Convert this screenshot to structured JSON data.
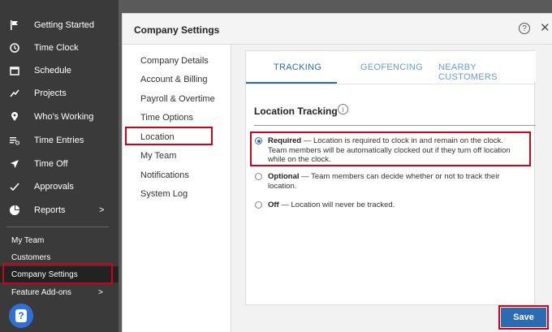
{
  "sidebar": {
    "items": [
      {
        "label": "Getting Started",
        "icon": "flag-icon"
      },
      {
        "label": "Time Clock",
        "icon": "clock-icon"
      },
      {
        "label": "Schedule",
        "icon": "calendar-icon"
      },
      {
        "label": "Projects",
        "icon": "projects-icon"
      },
      {
        "label": "Who's Working",
        "icon": "location-pin-icon"
      },
      {
        "label": "Time Entries",
        "icon": "time-entries-icon"
      },
      {
        "label": "Time Off",
        "icon": "plane-icon"
      },
      {
        "label": "Approvals",
        "icon": "checkmark-icon"
      },
      {
        "label": "Reports",
        "icon": "pie-chart-icon",
        "chevron": ">"
      }
    ],
    "sub_items": [
      {
        "label": "My Team"
      },
      {
        "label": "Customers"
      },
      {
        "label": "Company Settings"
      },
      {
        "label": "Feature Add-ons",
        "chevron": ">"
      }
    ],
    "help_symbol": "?"
  },
  "modal": {
    "title": "Company Settings",
    "help_symbol": "?",
    "close_symbol": "✕",
    "nav": [
      "Company Details",
      "Account & Billing",
      "Payroll & Overtime",
      "Time Options",
      "Location",
      "My Team",
      "Notifications",
      "System Log"
    ],
    "tabs": [
      "TRACKING",
      "GEOFENCING",
      "NEARBY CUSTOMERS"
    ],
    "section_title": "Location Tracking",
    "info_symbol": "i",
    "options": [
      {
        "label": "Required",
        "text": " — Location is required to clock in and remain on the clock. Team members will be automatically clocked out if they turn off location while on the clock.",
        "checked": true
      },
      {
        "label": "Optional",
        "text": " — Team members can decide whether or not to track their location.",
        "checked": false
      },
      {
        "label": "Off",
        "text": " — Location will never be tracked.",
        "checked": false
      }
    ],
    "save_label": "Save"
  },
  "colors": {
    "accent": "#2b6cb0",
    "highlight": "#d0021b",
    "sidebar_bg": "#3a3a3a"
  }
}
